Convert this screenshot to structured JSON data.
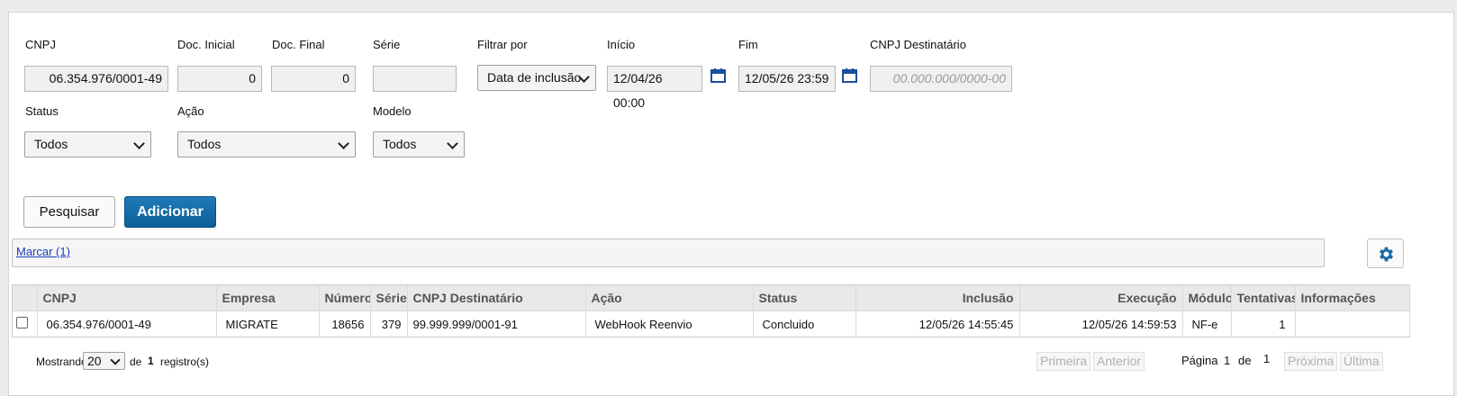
{
  "filters": {
    "cnpj": {
      "label": "CNPJ",
      "value": "06.354.976/0001-49"
    },
    "doc_inicial": {
      "label": "Doc. Inicial",
      "value": "0"
    },
    "doc_final": {
      "label": "Doc. Final",
      "value": "0"
    },
    "serie": {
      "label": "Série",
      "value": ""
    },
    "filtrar_por": {
      "label": "Filtrar por",
      "value": "Data de inclusão"
    },
    "inicio": {
      "label": "Início",
      "value": "12/04/26 00:00"
    },
    "fim": {
      "label": "Fim",
      "value": "12/05/26 23:59"
    },
    "cnpj_dest": {
      "label": "CNPJ Destinatário",
      "placeholder": "00.000.000/0000-00"
    },
    "status": {
      "label": "Status",
      "value": "Todos"
    },
    "acao": {
      "label": "Ação",
      "value": "Todos"
    },
    "modelo": {
      "label": "Modelo",
      "value": "Todos"
    }
  },
  "buttons": {
    "pesquisar": "Pesquisar",
    "adicionar": "Adicionar"
  },
  "toolbar": {
    "marcar": "Marcar (1)"
  },
  "table": {
    "headers": [
      "CNPJ",
      "Empresa",
      "Número",
      "Série",
      "CNPJ Destinatário",
      "Ação",
      "Status",
      "Inclusão",
      "Execução",
      "Módulo",
      "Tentativas",
      "Informações"
    ],
    "rows": [
      [
        "06.354.976/0001-49",
        "MIGRATE",
        "18656",
        "379",
        "99.999.999/0001-91",
        "WebHook Reenvio",
        "Concluido",
        "12/05/26 14:55:45",
        "12/05/26 14:59:53",
        "NF-e",
        "1",
        ""
      ]
    ]
  },
  "footer": {
    "mostrando": "Mostrando",
    "page_size": "20",
    "de": "de",
    "total": "1",
    "registros": "registro(s)",
    "primeira": "Primeira",
    "anterior": "Anterior",
    "pagina": "Página",
    "current_page": "1",
    "de2": "de",
    "total_pages": "1",
    "proxima": "Próxima",
    "ultima": "Última"
  },
  "colors": {
    "accent": "#0e5f98",
    "calendar": "#1b4f9c",
    "link": "#1a3cc2"
  },
  "icons": {
    "calendar": "calendar-icon",
    "settings": "gear-icon",
    "dropdown": "chevron-down-icon"
  }
}
